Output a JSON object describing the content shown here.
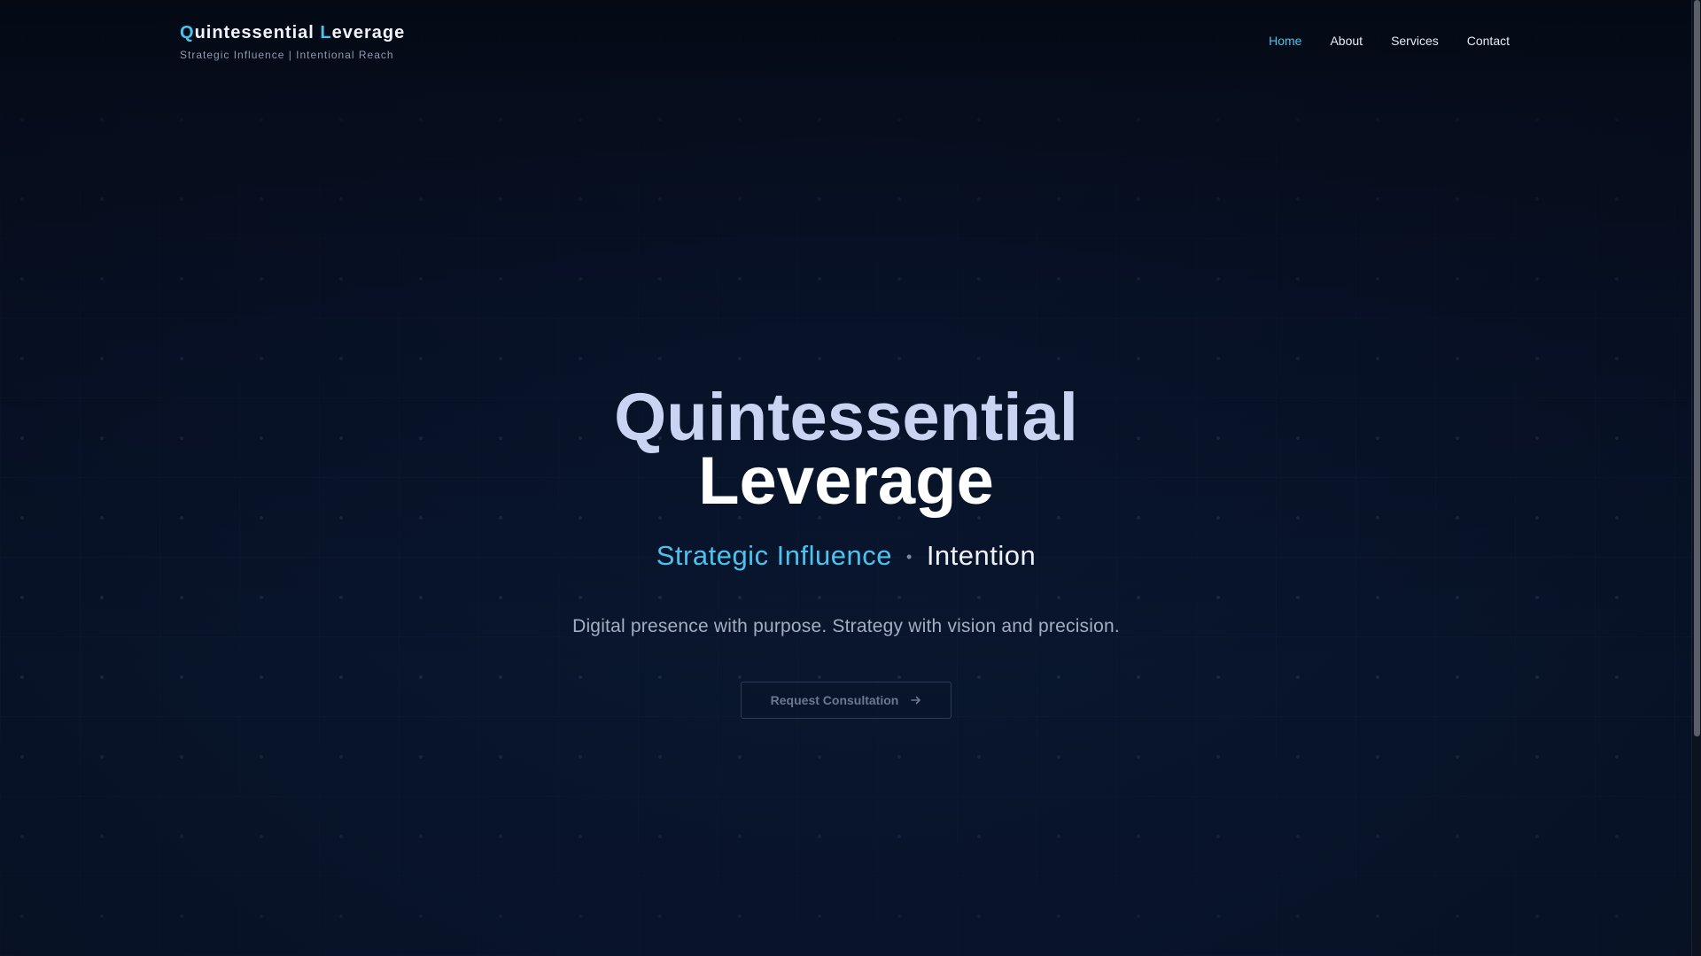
{
  "brand": {
    "name_first_letter": "Q",
    "name_first_rest": "uintessential ",
    "name_second_letter": "L",
    "name_second_rest": "everage",
    "tagline": "Strategic Influence | Intentional Reach"
  },
  "nav": {
    "items": [
      {
        "label": "Home",
        "active": true
      },
      {
        "label": "About",
        "active": false
      },
      {
        "label": "Services",
        "active": false
      },
      {
        "label": "Contact",
        "active": false
      }
    ]
  },
  "hero": {
    "title_line1": "Quintessential",
    "title_line2": "Leverage",
    "sub_a": "Strategic Influence",
    "sub_separator": "•",
    "sub_b": "Intention",
    "description": "Digital presence with purpose. Strategy with vision and precision.",
    "cta_label": "Request Consultation",
    "cta_icon": "arrow-right-icon"
  },
  "colors": {
    "accent": "#4cc2ef",
    "background": "#07101f",
    "title_light": "#c9d3f2"
  }
}
